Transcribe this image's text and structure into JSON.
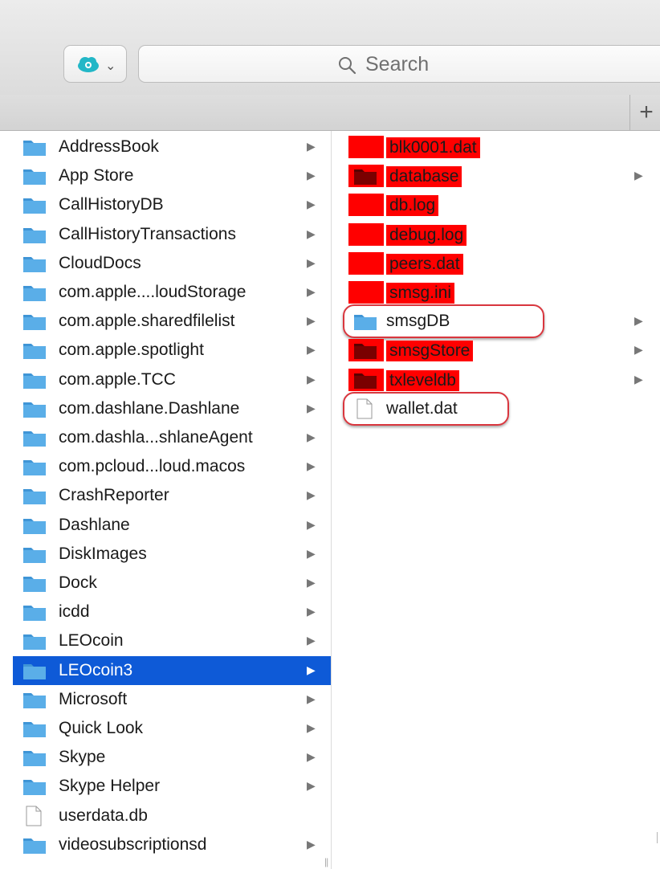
{
  "toolbar": {
    "cloud_button_icon": "pcloud-icon",
    "chevron": "⌄",
    "search_placeholder": "Search",
    "plus_label": "+"
  },
  "column1": {
    "items": [
      {
        "name": "AddressBook",
        "type": "folder",
        "has_children": true,
        "selected": false
      },
      {
        "name": "App Store",
        "type": "folder",
        "has_children": true,
        "selected": false
      },
      {
        "name": "CallHistoryDB",
        "type": "folder",
        "has_children": true,
        "selected": false
      },
      {
        "name": "CallHistoryTransactions",
        "type": "folder",
        "has_children": true,
        "selected": false
      },
      {
        "name": "CloudDocs",
        "type": "folder",
        "has_children": true,
        "selected": false
      },
      {
        "name": "com.apple....loudStorage",
        "type": "folder",
        "has_children": true,
        "selected": false
      },
      {
        "name": "com.apple.sharedfilelist",
        "type": "folder",
        "has_children": true,
        "selected": false
      },
      {
        "name": "com.apple.spotlight",
        "type": "folder",
        "has_children": true,
        "selected": false
      },
      {
        "name": "com.apple.TCC",
        "type": "folder",
        "has_children": true,
        "selected": false
      },
      {
        "name": "com.dashlane.Dashlane",
        "type": "folder",
        "has_children": true,
        "selected": false
      },
      {
        "name": "com.dashla...shlaneAgent",
        "type": "folder",
        "has_children": true,
        "selected": false
      },
      {
        "name": "com.pcloud...loud.macos",
        "type": "folder",
        "has_children": true,
        "selected": false
      },
      {
        "name": "CrashReporter",
        "type": "folder",
        "has_children": true,
        "selected": false
      },
      {
        "name": "Dashlane",
        "type": "folder",
        "has_children": true,
        "selected": false
      },
      {
        "name": "DiskImages",
        "type": "folder",
        "has_children": true,
        "selected": false
      },
      {
        "name": "Dock",
        "type": "folder",
        "has_children": true,
        "selected": false
      },
      {
        "name": "icdd",
        "type": "folder",
        "has_children": true,
        "selected": false
      },
      {
        "name": "LEOcoin",
        "type": "folder",
        "has_children": true,
        "selected": false
      },
      {
        "name": "LEOcoin3",
        "type": "folder",
        "has_children": true,
        "selected": true
      },
      {
        "name": "Microsoft",
        "type": "folder",
        "has_children": true,
        "selected": false
      },
      {
        "name": "Quick Look",
        "type": "folder",
        "has_children": true,
        "selected": false
      },
      {
        "name": "Skype",
        "type": "folder",
        "has_children": true,
        "selected": false
      },
      {
        "name": "Skype Helper",
        "type": "folder",
        "has_children": true,
        "selected": false
      },
      {
        "name": "userdata.db",
        "type": "file",
        "has_children": false,
        "selected": false
      },
      {
        "name": "videosubscriptionsd",
        "type": "folder",
        "has_children": true,
        "selected": false
      }
    ]
  },
  "column2": {
    "items": [
      {
        "name": "blk0001.dat",
        "type": "file",
        "has_children": false,
        "redacted": true,
        "circled": false
      },
      {
        "name": "database",
        "type": "folder",
        "has_children": true,
        "redacted": true,
        "circled": false
      },
      {
        "name": "db.log",
        "type": "file",
        "has_children": false,
        "redacted": true,
        "circled": false
      },
      {
        "name": "debug.log",
        "type": "file",
        "has_children": false,
        "redacted": true,
        "circled": false
      },
      {
        "name": "peers.dat",
        "type": "file",
        "has_children": false,
        "redacted": true,
        "circled": false
      },
      {
        "name": "smsg.ini",
        "type": "file",
        "has_children": false,
        "redacted": true,
        "circled": false
      },
      {
        "name": "smsgDB",
        "type": "folder",
        "has_children": true,
        "redacted": false,
        "circled": true
      },
      {
        "name": "smsgStore",
        "type": "folder",
        "has_children": true,
        "redacted": true,
        "circled": false
      },
      {
        "name": "txleveldb",
        "type": "folder",
        "has_children": true,
        "redacted": true,
        "circled": false
      },
      {
        "name": "wallet.dat",
        "type": "file",
        "has_children": false,
        "redacted": false,
        "circled": true
      }
    ]
  },
  "colors": {
    "selection": "#0e5ad7",
    "folder_blue": "#5aaee8",
    "redaction_red": "#ff0000",
    "annotation_ring": "#d9363e"
  }
}
